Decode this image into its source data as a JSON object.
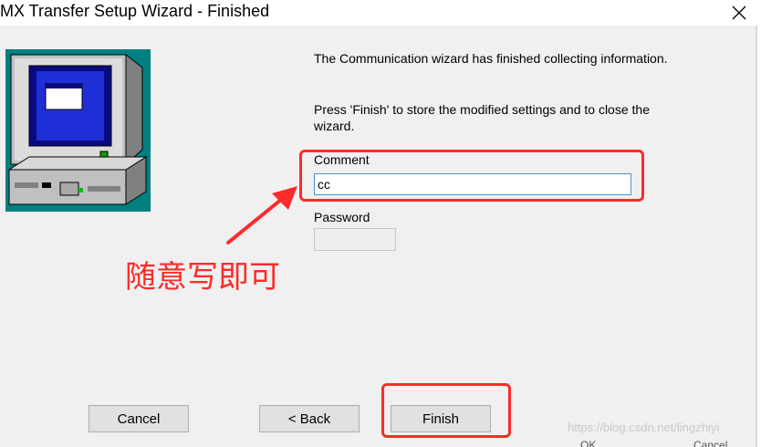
{
  "window": {
    "title": "MX Transfer Setup Wizard - Finished"
  },
  "message": {
    "line1": "The Communication wizard has finished collecting information.",
    "line2": "Press 'Finish' to store the modified settings and to close the wizard."
  },
  "form": {
    "comment_label": "Comment",
    "comment_value": "cc",
    "password_label": "Password",
    "password_value": ""
  },
  "annotation": {
    "text": "随意写即可",
    "color": "#ff2a2a"
  },
  "buttons": {
    "cancel": "Cancel",
    "back": "< Back",
    "finish": "Finish"
  },
  "watermark": "https://blog.csdn.net/lingzhiyi",
  "hidden_buttons": {
    "ok": "OK",
    "cancel": "Cancel"
  },
  "icons": {
    "close": "close-icon",
    "illustration": "computer-monitor-icon",
    "arrow": "annotation-arrow-icon"
  }
}
